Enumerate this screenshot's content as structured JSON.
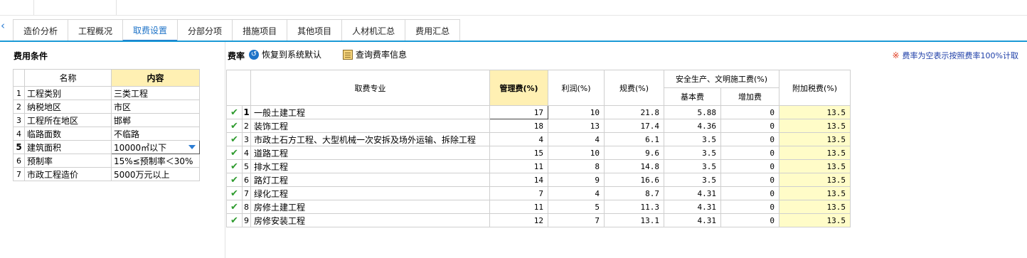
{
  "nav": {
    "collapse_icon": "chevron-left-icon",
    "tabs": [
      {
        "label": "造价分析",
        "active": false
      },
      {
        "label": "工程概况",
        "active": false
      },
      {
        "label": "取费设置",
        "active": true
      },
      {
        "label": "分部分项",
        "active": false
      },
      {
        "label": "措施项目",
        "active": false
      },
      {
        "label": "其他项目",
        "active": false
      },
      {
        "label": "人材机汇总",
        "active": false
      },
      {
        "label": "费用汇总",
        "active": false
      }
    ]
  },
  "conditions": {
    "title": "费用条件",
    "header": {
      "name": "名称",
      "value": "内容"
    },
    "rows": [
      {
        "no": "1",
        "name": "工程类别",
        "value": "三类工程"
      },
      {
        "no": "2",
        "name": "纳税地区",
        "value": "市区"
      },
      {
        "no": "3",
        "name": "工程所在地区",
        "value": "邯郸"
      },
      {
        "no": "4",
        "name": "临路面数",
        "value": "不临路"
      },
      {
        "no": "5",
        "name": "建筑面积",
        "value": "10000㎡以下",
        "selected": true
      },
      {
        "no": "6",
        "name": "预制率",
        "value": "15%≤预制率＜30%"
      },
      {
        "no": "7",
        "name": "市政工程造价",
        "value": "5000万元以上"
      }
    ]
  },
  "rates": {
    "title": "费率",
    "restore_label": "恢复到系统默认",
    "query_label": "查询费率信息",
    "note": "费率为空表示按照费率100%计取",
    "note_icon": "※",
    "header": {
      "specialty": "取费专业",
      "mgmt": "管理费(%)",
      "profit": "利润(%)",
      "gui": "规费(%)",
      "safety_group": "安全生产、文明施工费(%)",
      "base": "基本费",
      "add": "增加费",
      "tax": "附加税费(%)"
    },
    "rows": [
      {
        "no": "1",
        "name": "一般土建工程",
        "mgmt": "17",
        "profit": "10",
        "gui": "21.8",
        "base": "5.88",
        "add": "0",
        "tax": "13.5"
      },
      {
        "no": "2",
        "name": "装饰工程",
        "mgmt": "18",
        "profit": "13",
        "gui": "17.4",
        "base": "4.36",
        "add": "0",
        "tax": "13.5"
      },
      {
        "no": "3",
        "name": "市政土石方工程、大型机械一次安拆及场外运输、拆除工程",
        "mgmt": "4",
        "profit": "4",
        "gui": "6.1",
        "base": "3.5",
        "add": "0",
        "tax": "13.5"
      },
      {
        "no": "4",
        "name": "道路工程",
        "mgmt": "15",
        "profit": "10",
        "gui": "9.6",
        "base": "3.5",
        "add": "0",
        "tax": "13.5"
      },
      {
        "no": "5",
        "name": "排水工程",
        "mgmt": "11",
        "profit": "8",
        "gui": "14.8",
        "base": "3.5",
        "add": "0",
        "tax": "13.5"
      },
      {
        "no": "6",
        "name": "路灯工程",
        "mgmt": "14",
        "profit": "9",
        "gui": "16.6",
        "base": "3.5",
        "add": "0",
        "tax": "13.5"
      },
      {
        "no": "7",
        "name": "绿化工程",
        "mgmt": "7",
        "profit": "4",
        "gui": "8.7",
        "base": "4.31",
        "add": "0",
        "tax": "13.5"
      },
      {
        "no": "8",
        "name": "房修土建工程",
        "mgmt": "11",
        "profit": "5",
        "gui": "11.3",
        "base": "4.31",
        "add": "0",
        "tax": "13.5"
      },
      {
        "no": "9",
        "name": "房修安装工程",
        "mgmt": "12",
        "profit": "7",
        "gui": "13.1",
        "base": "4.31",
        "add": "0",
        "tax": "13.5"
      }
    ]
  }
}
